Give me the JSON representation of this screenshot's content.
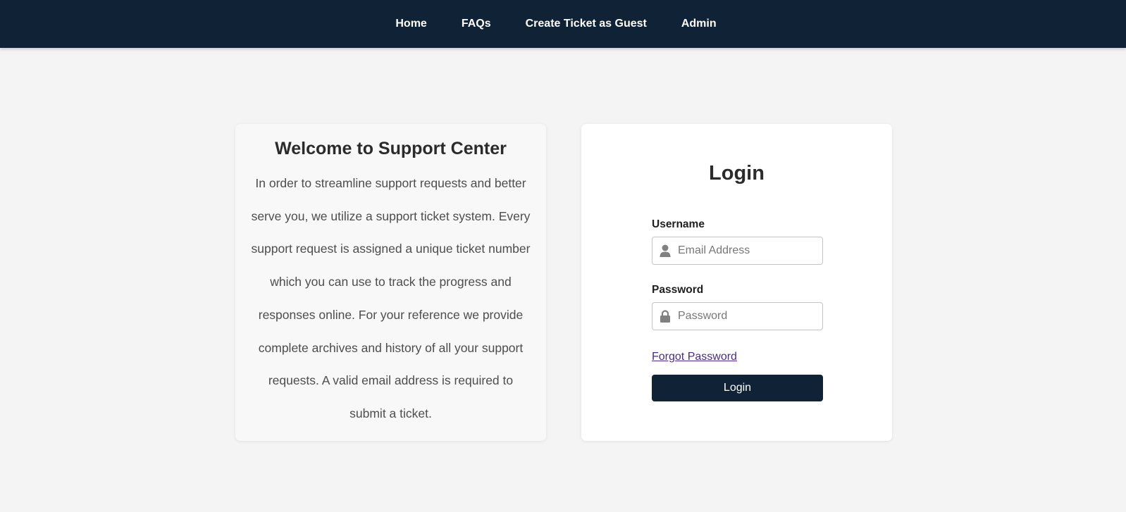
{
  "nav": {
    "items": [
      {
        "label": "Home"
      },
      {
        "label": "FAQs"
      },
      {
        "label": "Create Ticket as Guest"
      },
      {
        "label": "Admin"
      }
    ]
  },
  "welcome": {
    "title": "Welcome to Support Center",
    "body": "In order to streamline support requests and better serve you, we utilize a support ticket system. Every support request is assigned a unique ticket number which you can use to track the progress and responses online. For your reference we provide complete archives and history of all your support requests. A valid email address is required to submit a ticket."
  },
  "login": {
    "title": "Login",
    "username_label": "Username",
    "username_placeholder": "Email Address",
    "username_icon": "user-icon",
    "password_label": "Password",
    "password_placeholder": "Password",
    "password_icon": "lock-icon",
    "forgot_label": "Forgot Password",
    "submit_label": "Login"
  },
  "colors": {
    "navbar_bg": "#0f2236",
    "page_bg": "#f4f4f4",
    "button_bg": "#0f2236",
    "link": "#4a2a8a"
  }
}
